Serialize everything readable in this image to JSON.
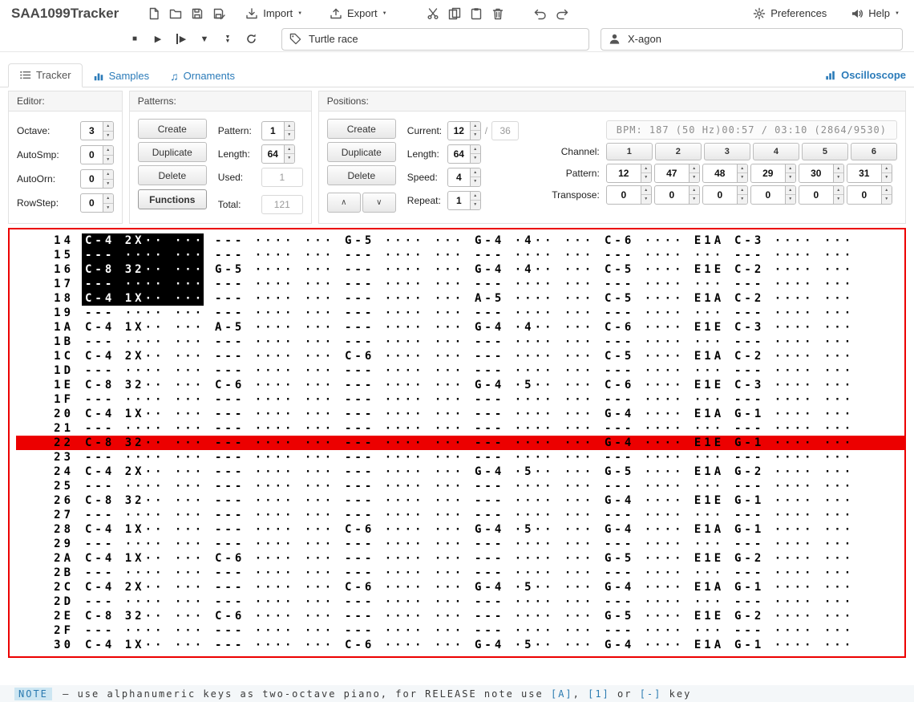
{
  "app": {
    "title": "SAA1099Tracker"
  },
  "menus": {
    "import": "Import",
    "export": "Export",
    "preferences": "Preferences",
    "help": "Help"
  },
  "song": {
    "title": "Turtle race",
    "author": "X-agon"
  },
  "tabs": {
    "tracker": "Tracker",
    "samples": "Samples",
    "ornaments": "Ornaments",
    "oscilloscope": "Oscilloscope"
  },
  "icons": {
    "stop": "■",
    "play": "▶",
    "seek_down": "▼",
    "caret": "▼",
    "ornament_note": "♫",
    "up_chevron": "∧",
    "down_chevron": "∨"
  },
  "editor": {
    "title": "Editor:",
    "octave_label": "Octave:",
    "octave": "3",
    "autosmp_label": "AutoSmp:",
    "autosmp": "0",
    "autoorn_label": "AutoOrn:",
    "autoorn": "0",
    "rowstep_label": "RowStep:",
    "rowstep": "0"
  },
  "patterns": {
    "title": "Patterns:",
    "create": "Create",
    "duplicate": "Duplicate",
    "delete": "Delete",
    "functions": "Functions",
    "pattern_label": "Pattern:",
    "pattern": "1",
    "length_label": "Length:",
    "length": "64",
    "used_label": "Used:",
    "used": "1",
    "total_label": "Total:",
    "total": "121"
  },
  "positions": {
    "title": "Positions:",
    "create": "Create",
    "duplicate": "Duplicate",
    "delete": "Delete",
    "current_label": "Current:",
    "current": "12",
    "slash": "/",
    "count": "36",
    "length_label": "Length:",
    "length": "64",
    "speed_label": "Speed:",
    "speed": "4",
    "repeat_label": "Repeat:",
    "repeat": "1",
    "bpm_info": "BPM: 187 (50 Hz)",
    "time_info": "00:57 / 03:10 (2864/9530)",
    "channel_label": "Channel:",
    "channels": [
      "1",
      "2",
      "3",
      "4",
      "5",
      "6"
    ],
    "pattern_row_label": "Pattern:",
    "channel_patterns": [
      "12",
      "47",
      "48",
      "29",
      "30",
      "31"
    ],
    "transpose_label": "Transpose:",
    "transpose": [
      "0",
      "0",
      "0",
      "0",
      "0",
      "0"
    ]
  },
  "tracker": {
    "play_row": 14,
    "selection": {
      "row_start": 0,
      "row_end": 4,
      "channel": 0
    },
    "rows": [
      {
        "n": "14",
        "c": [
          "C-4 2X·· ···",
          "--- ···· ···",
          "G-5 ···· ···",
          "G-4 ·4·· ···",
          "C-6 ···· E1A",
          "C-3 ···· ···"
        ]
      },
      {
        "n": "15",
        "c": [
          "--- ···· ···",
          "--- ···· ···",
          "--- ···· ···",
          "--- ···· ···",
          "--- ···· ···",
          "--- ···· ···"
        ]
      },
      {
        "n": "16",
        "c": [
          "C-8 32·· ···",
          "G-5 ···· ···",
          "--- ···· ···",
          "G-4 ·4·· ···",
          "C-5 ···· E1E",
          "C-2 ···· ···"
        ]
      },
      {
        "n": "17",
        "c": [
          "--- ···· ···",
          "--- ···· ···",
          "--- ···· ···",
          "--- ···· ···",
          "--- ···· ···",
          "--- ···· ···"
        ]
      },
      {
        "n": "18",
        "c": [
          "C-4 1X·· ···",
          "--- ···· ···",
          "--- ···· ···",
          "A-5 ···· ···",
          "C-5 ···· E1A",
          "C-2 ···· ···"
        ]
      },
      {
        "n": "19",
        "c": [
          "--- ···· ···",
          "--- ···· ···",
          "--- ···· ···",
          "--- ···· ···",
          "--- ···· ···",
          "--- ···· ···"
        ]
      },
      {
        "n": "1A",
        "c": [
          "C-4 1X·· ···",
          "A-5 ···· ···",
          "--- ···· ···",
          "G-4 ·4·· ···",
          "C-6 ···· E1E",
          "C-3 ···· ···"
        ]
      },
      {
        "n": "1B",
        "c": [
          "--- ···· ···",
          "--- ···· ···",
          "--- ···· ···",
          "--- ···· ···",
          "--- ···· ···",
          "--- ···· ···"
        ]
      },
      {
        "n": "1C",
        "c": [
          "C-4 2X·· ···",
          "--- ···· ···",
          "C-6 ···· ···",
          "--- ···· ···",
          "C-5 ···· E1A",
          "C-2 ···· ···"
        ]
      },
      {
        "n": "1D",
        "c": [
          "--- ···· ···",
          "--- ···· ···",
          "--- ···· ···",
          "--- ···· ···",
          "--- ···· ···",
          "--- ···· ···"
        ]
      },
      {
        "n": "1E",
        "c": [
          "C-8 32·· ···",
          "C-6 ···· ···",
          "--- ···· ···",
          "G-4 ·5·· ···",
          "C-6 ···· E1E",
          "C-3 ···· ···"
        ]
      },
      {
        "n": "1F",
        "c": [
          "--- ···· ···",
          "--- ···· ···",
          "--- ···· ···",
          "--- ···· ···",
          "--- ···· ···",
          "--- ···· ···"
        ]
      },
      {
        "n": "20",
        "c": [
          "C-4 1X·· ···",
          "--- ···· ···",
          "--- ···· ···",
          "--- ···· ···",
          "G-4 ···· E1A",
          "G-1 ···· ···"
        ]
      },
      {
        "n": "21",
        "c": [
          "--- ···· ···",
          "--- ···· ···",
          "--- ···· ···",
          "--- ···· ···",
          "--- ···· ···",
          "--- ···· ···"
        ]
      },
      {
        "n": "22",
        "c": [
          "C-8 32·· ···",
          "--- ···· ···",
          "--- ···· ···",
          "--- ···· ···",
          "G-4 ···· E1E",
          "G-1 ···· ···"
        ]
      },
      {
        "n": "23",
        "c": [
          "--- ···· ···",
          "--- ···· ···",
          "--- ···· ···",
          "--- ···· ···",
          "--- ···· ···",
          "--- ···· ···"
        ]
      },
      {
        "n": "24",
        "c": [
          "C-4 2X·· ···",
          "--- ···· ···",
          "--- ···· ···",
          "G-4 ·5·· ···",
          "G-5 ···· E1A",
          "G-2 ···· ···"
        ]
      },
      {
        "n": "25",
        "c": [
          "--- ···· ···",
          "--- ···· ···",
          "--- ···· ···",
          "--- ···· ···",
          "--- ···· ···",
          "--- ···· ···"
        ]
      },
      {
        "n": "26",
        "c": [
          "C-8 32·· ···",
          "--- ···· ···",
          "--- ···· ···",
          "--- ···· ···",
          "G-4 ···· E1E",
          "G-1 ···· ···"
        ]
      },
      {
        "n": "27",
        "c": [
          "--- ···· ···",
          "--- ···· ···",
          "--- ···· ···",
          "--- ···· ···",
          "--- ···· ···",
          "--- ···· ···"
        ]
      },
      {
        "n": "28",
        "c": [
          "C-4 1X·· ···",
          "--- ···· ···",
          "C-6 ···· ···",
          "G-4 ·5·· ···",
          "G-4 ···· E1A",
          "G-1 ···· ···"
        ]
      },
      {
        "n": "29",
        "c": [
          "--- ···· ···",
          "--- ···· ···",
          "--- ···· ···",
          "--- ···· ···",
          "--- ···· ···",
          "--- ···· ···"
        ]
      },
      {
        "n": "2A",
        "c": [
          "C-4 1X·· ···",
          "C-6 ···· ···",
          "--- ···· ···",
          "--- ···· ···",
          "G-5 ···· E1E",
          "G-2 ···· ···"
        ]
      },
      {
        "n": "2B",
        "c": [
          "--- ···· ···",
          "--- ···· ···",
          "--- ···· ···",
          "--- ···· ···",
          "--- ···· ···",
          "--- ···· ···"
        ]
      },
      {
        "n": "2C",
        "c": [
          "C-4 2X·· ···",
          "--- ···· ···",
          "C-6 ···· ···",
          "G-4 ·5·· ···",
          "G-4 ···· E1A",
          "G-1 ···· ···"
        ]
      },
      {
        "n": "2D",
        "c": [
          "--- ···· ···",
          "--- ···· ···",
          "--- ···· ···",
          "--- ···· ···",
          "--- ···· ···",
          "--- ···· ···"
        ]
      },
      {
        "n": "2E",
        "c": [
          "C-8 32·· ···",
          "C-6 ···· ···",
          "--- ···· ···",
          "--- ···· ···",
          "G-5 ···· E1E",
          "G-2 ···· ···"
        ]
      },
      {
        "n": "2F",
        "c": [
          "--- ···· ···",
          "--- ···· ···",
          "--- ···· ···",
          "--- ···· ···",
          "--- ···· ···",
          "--- ···· ···"
        ]
      },
      {
        "n": "30",
        "c": [
          "C-4 1X·· ···",
          "--- ···· ···",
          "C-6 ···· ···",
          "G-4 ·5·· ···",
          "G-4 ···· E1A",
          "G-1 ···· ···"
        ]
      }
    ]
  },
  "statusbar": {
    "badge": "NOTE",
    "seg1": " — use alphanumeric keys as two-octave piano, for RELEASE note use ",
    "key1": "[A]",
    "seg2": ", ",
    "key2": "[1]",
    "seg3": " or ",
    "key3": "[-]",
    "seg4": " key"
  }
}
